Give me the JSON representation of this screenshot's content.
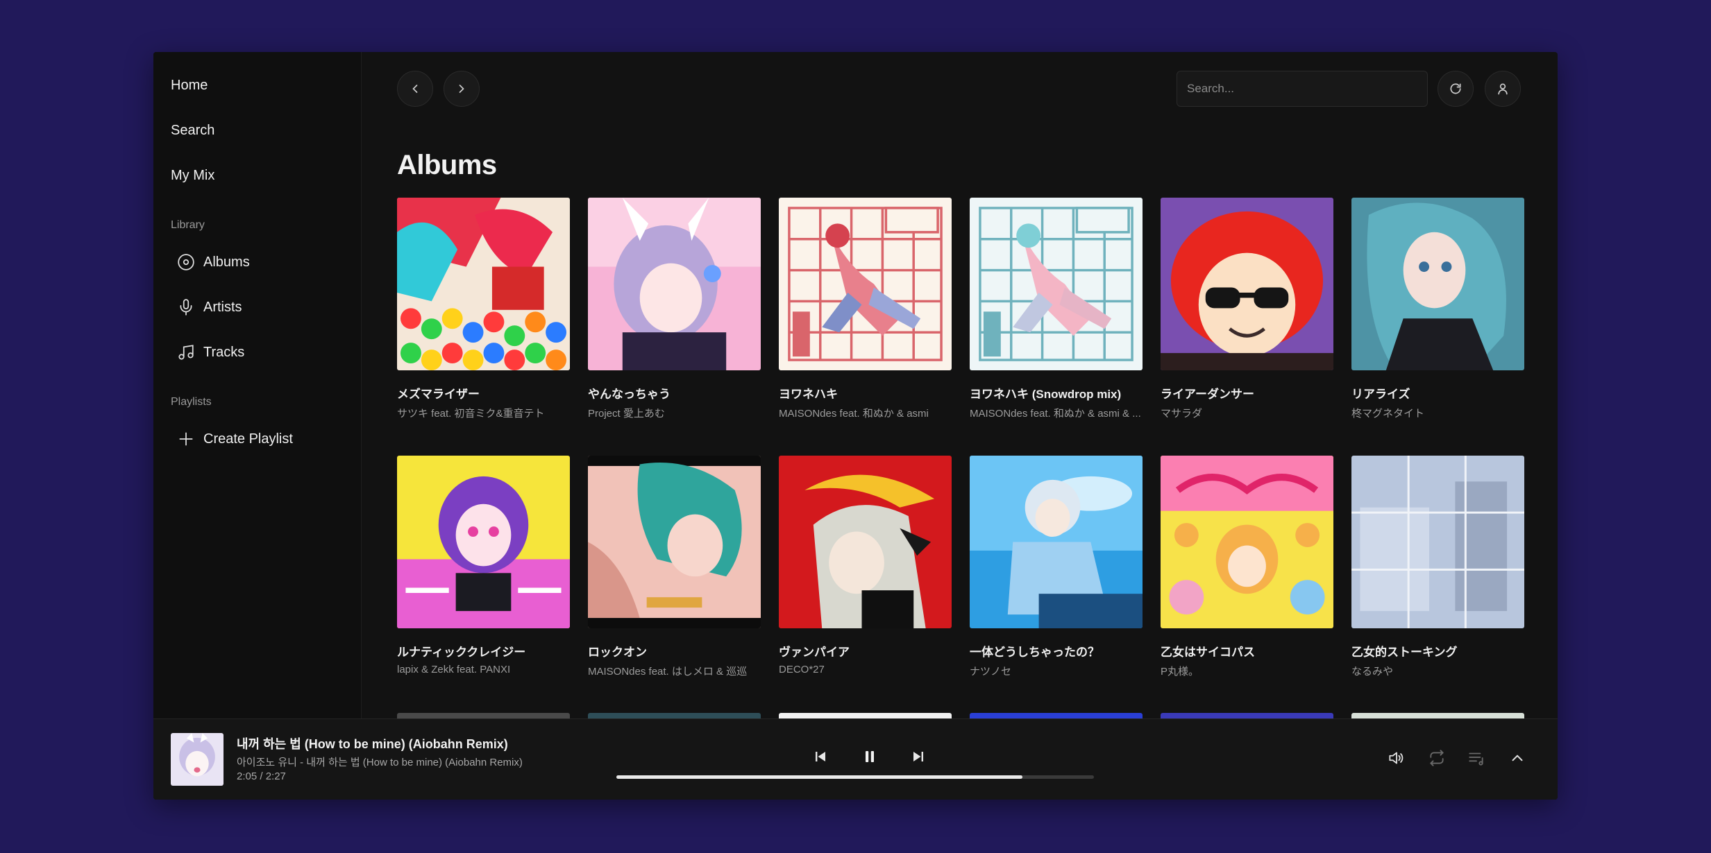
{
  "sidebar": {
    "nav": [
      {
        "label": "Home"
      },
      {
        "label": "Search"
      },
      {
        "label": "My Mix"
      }
    ],
    "library_heading": "Library",
    "library": [
      {
        "label": "Albums",
        "icon": "disc-icon"
      },
      {
        "label": "Artists",
        "icon": "microphone-icon"
      },
      {
        "label": "Tracks",
        "icon": "music-note-icon"
      }
    ],
    "playlists_heading": "Playlists",
    "create_playlist": "Create Playlist"
  },
  "header": {
    "search_placeholder": "Search..."
  },
  "main": {
    "title": "Albums",
    "albums": [
      {
        "title": "メズマライザー",
        "artist": "サツキ feat. 初音ミク&重音テト"
      },
      {
        "title": "やんなっちゃう",
        "artist": "Project 愛上あむ"
      },
      {
        "title": "ヨワネハキ",
        "artist": "MAISONdes feat. 和ぬか & asmi"
      },
      {
        "title": "ヨワネハキ (Snowdrop mix)",
        "artist": "MAISONdes feat. 和ぬか & asmi & ..."
      },
      {
        "title": "ライアーダンサー",
        "artist": "マサラダ"
      },
      {
        "title": "リアライズ",
        "artist": "柊マグネタイト"
      },
      {
        "title": "ルナティッククレイジー",
        "artist": "lapix & Zekk feat. PANXI"
      },
      {
        "title": "ロックオン",
        "artist": "MAISONdes feat. はしメロ & 巡巡"
      },
      {
        "title": "ヴァンパイア",
        "artist": "DECO*27"
      },
      {
        "title": "一体どうしちゃったの？",
        "artist": "ナツノセ"
      },
      {
        "title": "乙女はサイコパス",
        "artist": "P丸様。"
      },
      {
        "title": "乙女的ストーキング",
        "artist": "なるみや"
      }
    ]
  },
  "player": {
    "title": "내꺼 하는 법 (How to be mine) (Aiobahn Remix)",
    "subtitle": "아이조노 유니 - 내꺼 하는 법 (How to be mine) (Aiobahn Remix)",
    "time": "2:05 / 2:27",
    "progress": 0.85
  },
  "colors": {
    "background": "#21195a",
    "window": "#121212",
    "text": "#f2f2f2",
    "muted": "#9c9c9c"
  }
}
